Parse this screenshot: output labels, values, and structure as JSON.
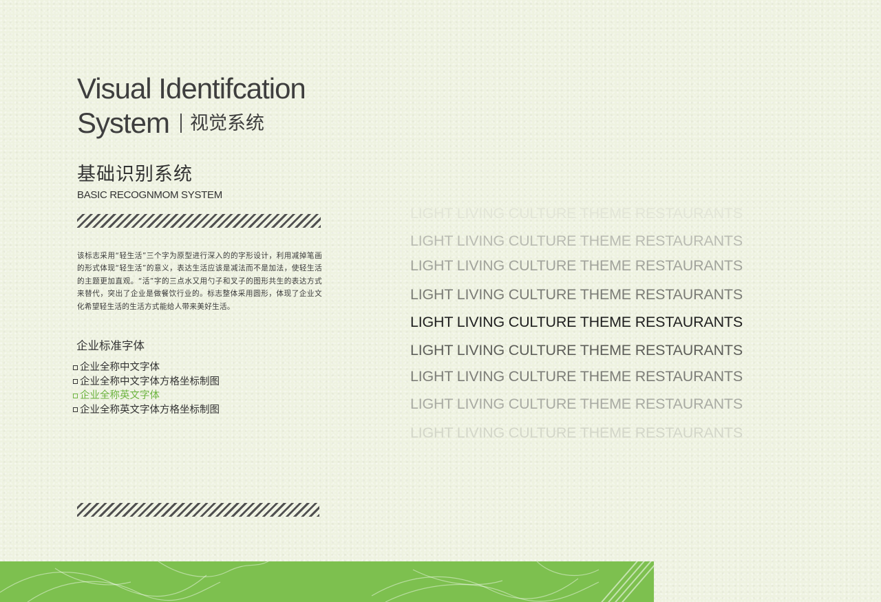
{
  "header": {
    "title_line1": "Visual Identifcation",
    "title_line2": "System",
    "title_cn": "视觉系统"
  },
  "section": {
    "title": "基础识别系统",
    "subtitle": "BASIC RECOGNMOM SYSTEM"
  },
  "description": "该标志采用“轻生活”三个字为原型进行深入的的字形设计，利用减掉笔画的形式体现“轻生活”的意义，表达生活应该是减法而不是加法，使轻生活的主题更加直观。“活”字的三点水又用勺子和叉子的图形共生的表达方式来替代，突出了企业是做餐饮行业的。标志整体采用圆形，体现了企业文化希望轻生活的生活方式能给人带来美好生活。",
  "font_section": {
    "title": "企业标准字体",
    "items": [
      {
        "label": "企业全称中文字体"
      },
      {
        "label": "企业全称中文字体方格坐标制图"
      },
      {
        "label": "企业全称英文字体"
      },
      {
        "label": "企业全称英文字体方格坐标制图"
      }
    ],
    "active_index": 2,
    "active_color": "#6cb33f"
  },
  "samples": {
    "lines": [
      {
        "text": "LIGHT LIVING CULTURE THEME RESTAURANTS",
        "color": "#e2e5d7"
      },
      {
        "text": "LIGHT LIVING CULTURE THEME RESTAURANTS",
        "color": "#b9bbb2"
      },
      {
        "text": "LIGHT LIVING CULTURE THEME RESTAURANTS",
        "color": "#a1a39b"
      },
      {
        "text": "LIGHT LIVING CULTURE THEME RESTAURANTS",
        "color": "#7b7c76"
      },
      {
        "text": "LIGHT LIVING CULTURE THEME RESTAURANTS",
        "color": "#1f1f1f"
      },
      {
        "text": "LIGHT LIVING CULTURE THEME RESTAURANTS",
        "color": "#5e5f5a"
      },
      {
        "text": "LIGHT LIVING CULTURE THEME RESTAURANTS",
        "color": "#7d7e78"
      },
      {
        "text": "LIGHT LIVING CULTURE THEME RESTAURANTS",
        "color": "#a9aba3"
      },
      {
        "text": "LIGHT LIVING CULTURE THEME RESTAURANTS",
        "color": "#d3d6c9"
      }
    ]
  },
  "colors": {
    "background": "#eef2e0",
    "footer_green": "#7dc04f",
    "text_dark": "#3e3e3e"
  }
}
